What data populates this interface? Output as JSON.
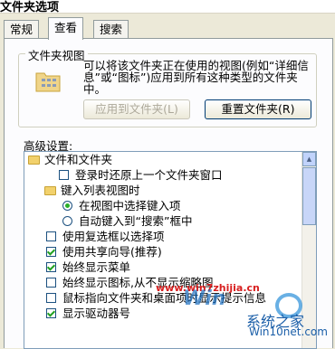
{
  "window": {
    "title": "文件夹选项"
  },
  "tabs": [
    {
      "label": "常规",
      "active": false
    },
    {
      "label": "查看",
      "active": true
    },
    {
      "label": "搜索",
      "active": false
    }
  ],
  "folder_views": {
    "title": "文件夹视图",
    "description": "可以将该文件夹正在使用的视图(例如“详细信息”或“图标”)应用到所有这种类型的文件夹中。",
    "apply_button": "应用到文件夹(L)",
    "reset_button": "重置文件夹(R)"
  },
  "advanced": {
    "label": "高级设置:",
    "items": [
      {
        "kind": "folder",
        "label": "文件和文件夹"
      },
      {
        "kind": "checkbox",
        "checked": false,
        "label": "登录时还原上一个文件夹窗口"
      },
      {
        "kind": "folder",
        "label": "键入列表视图时"
      },
      {
        "kind": "radio",
        "checked": true,
        "label": "在视图中选择键入项"
      },
      {
        "kind": "radio",
        "checked": false,
        "label": "自动键入到“搜索”框中"
      },
      {
        "kind": "checkbox",
        "checked": false,
        "label": "使用复选框以选择项"
      },
      {
        "kind": "checkbox",
        "checked": true,
        "label": "使用共享向导(推荐)"
      },
      {
        "kind": "checkbox",
        "checked": true,
        "label": "始终显示菜单"
      },
      {
        "kind": "checkbox",
        "checked": false,
        "label": "始终显示图标,从不显示缩略图"
      },
      {
        "kind": "checkbox",
        "checked": false,
        "label": "鼠标指向文件夹和桌面项时显示提示信息"
      },
      {
        "kind": "checkbox",
        "checked": true,
        "label": "显示驱动器号"
      }
    ]
  },
  "watermark": {
    "url": "www.win7zhijia.cn",
    "logo": "Win",
    "brand": "系统之家",
    "site": "Win10net.com"
  }
}
